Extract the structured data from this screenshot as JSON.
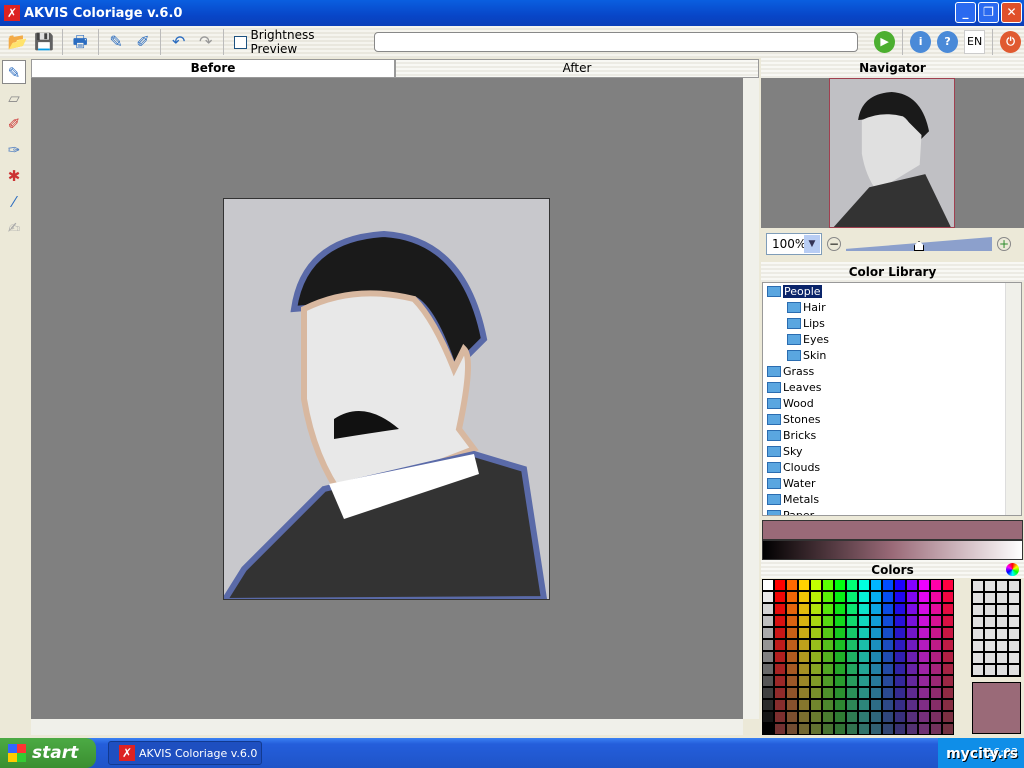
{
  "window": {
    "title": "AKVIS Coloriage v.6.0",
    "minimize": "_",
    "restore": "❐",
    "close": "✕"
  },
  "toolbar": {
    "brightness_preview": "Brightness Preview",
    "language": "EN"
  },
  "tabs": [
    {
      "label": "Before",
      "active": true
    },
    {
      "label": "After",
      "active": false
    }
  ],
  "navigator": {
    "title": "Navigator",
    "zoom": "100%",
    "zoom_slider_fraction": 0.5
  },
  "color_library": {
    "title": "Color Library",
    "items": [
      {
        "label": "People",
        "level": 0,
        "selected": true
      },
      {
        "label": "Hair",
        "level": 1
      },
      {
        "label": "Lips",
        "level": 1
      },
      {
        "label": "Eyes",
        "level": 1
      },
      {
        "label": "Skin",
        "level": 1
      },
      {
        "label": "Grass",
        "level": 0
      },
      {
        "label": "Leaves",
        "level": 0
      },
      {
        "label": "Wood",
        "level": 0
      },
      {
        "label": "Stones",
        "level": 0
      },
      {
        "label": "Bricks",
        "level": 0
      },
      {
        "label": "Sky",
        "level": 0
      },
      {
        "label": "Clouds",
        "level": 0
      },
      {
        "label": "Water",
        "level": 0
      },
      {
        "label": "Metals",
        "level": 0
      },
      {
        "label": "Paper",
        "level": 0
      }
    ]
  },
  "colors": {
    "title": "Colors",
    "current": "#9a6a78"
  },
  "taskbar": {
    "start": "start",
    "task": "AKVIS Coloriage v.6.0",
    "clock": "16:03",
    "watermark": "mycity.rs"
  }
}
